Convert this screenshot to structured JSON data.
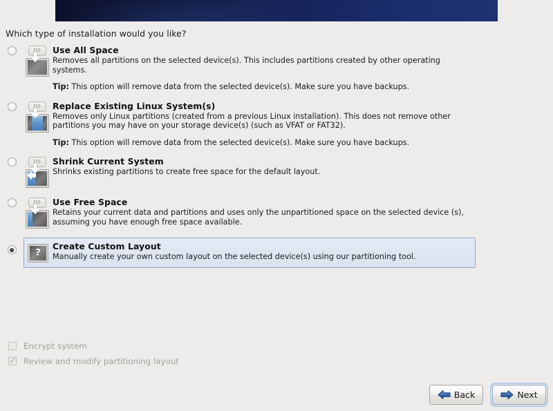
{
  "header": {
    "banner_color_start": "#0c122c",
    "banner_color_end": "#1e3173"
  },
  "question": "Which type of installation would you like?",
  "options": [
    {
      "id": "use-all-space",
      "title": "Use All Space",
      "description": "Removes all partitions on the selected device(s).  This includes partitions created by other operating systems.",
      "tip_label": "Tip:",
      "tip_text": " This option will remove data from the selected device(s).  Make sure you have backups.",
      "icon": "disk-erase-icon",
      "os_chip": "OS",
      "selected": false
    },
    {
      "id": "replace-existing-linux",
      "title": "Replace Existing Linux System(s)",
      "description": "Removes only Linux partitions (created from a previous Linux installation).  This does not remove other partitions you may have on your storage device(s) (such as VFAT or FAT32).",
      "tip_label": "Tip:",
      "tip_text": " This option will remove data from the selected device(s).  Make sure you have backups.",
      "icon": "disk-replace-linux-icon",
      "os_chip": "OS",
      "selected": false
    },
    {
      "id": "shrink-current-system",
      "title": "Shrink Current System",
      "description": "Shrinks existing partitions to create free space for the default layout.",
      "tip_label": "",
      "tip_text": "",
      "icon": "disk-shrink-icon",
      "os_chip": "OS",
      "selected": false
    },
    {
      "id": "use-free-space",
      "title": "Use Free Space",
      "description": "Retains your current data and partitions and uses only the unpartitioned space on the selected device (s), assuming you have enough free space available.",
      "tip_label": "",
      "tip_text": "",
      "icon": "disk-free-space-icon",
      "os_chip": "OS",
      "selected": false
    },
    {
      "id": "create-custom-layout",
      "title": "Create Custom Layout",
      "description": "Manually create your own custom layout on the selected device(s) using our partitioning tool.",
      "tip_label": "",
      "tip_text": "",
      "icon": "question-mark-icon",
      "os_chip": "",
      "selected": true
    }
  ],
  "checkboxes": [
    {
      "id": "encrypt-system",
      "label": "Encrypt system",
      "checked": false,
      "disabled": true
    },
    {
      "id": "review-modify-partitioning",
      "label": "Review and modify partitioning layout",
      "checked": true,
      "disabled": true
    }
  ],
  "footer": {
    "back_label": "Back",
    "next_label": "Next",
    "back_icon": "arrow-left-icon",
    "next_icon": "arrow-right-icon",
    "next_focused": true,
    "arrow_color": "#2c5aa0"
  }
}
